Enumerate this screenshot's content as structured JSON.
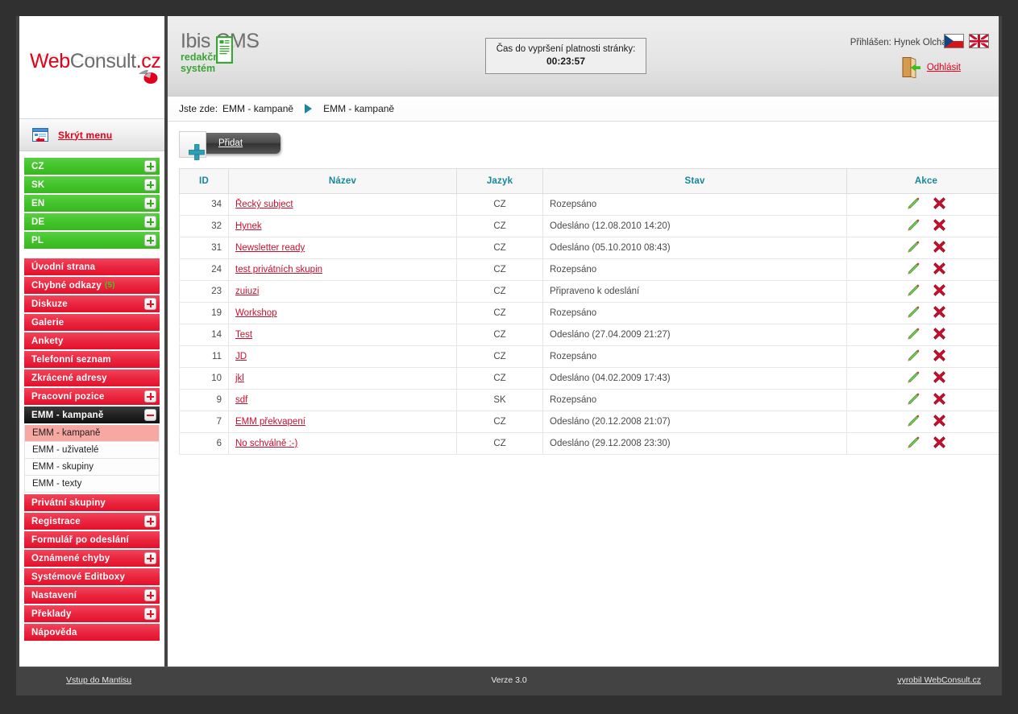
{
  "brand": {
    "logo_web": "Web",
    "logo_consult": "Consult",
    "logo_cz": ".cz",
    "cms_title": "Ibis CMS",
    "cms_sub_line1": "redakční",
    "cms_sub_line2": "systém"
  },
  "sidebar": {
    "hide_menu_label": "Skrýt menu",
    "languages": [
      {
        "label": "CZ",
        "toggle": "plus"
      },
      {
        "label": "SK",
        "toggle": "plus"
      },
      {
        "label": "EN",
        "toggle": "plus"
      },
      {
        "label": "DE",
        "toggle": "plus"
      },
      {
        "label": "PL",
        "toggle": "plus"
      }
    ],
    "menu": [
      {
        "label": "Úvodní strana",
        "toggle": null,
        "badge": null
      },
      {
        "label": "Chybné odkazy",
        "toggle": null,
        "badge": "(5)"
      },
      {
        "label": "Diskuze",
        "toggle": "plus",
        "badge": null
      },
      {
        "label": "Galerie",
        "toggle": null,
        "badge": null
      },
      {
        "label": "Ankety",
        "toggle": null,
        "badge": null
      },
      {
        "label": "Telefonní seznam",
        "toggle": null,
        "badge": null
      },
      {
        "label": "Zkrácené adresy",
        "toggle": null,
        "badge": null
      },
      {
        "label": "Pracovní pozice",
        "toggle": "plus",
        "badge": null
      }
    ],
    "expanded": {
      "label": "EMM - kampaně",
      "toggle": "minus"
    },
    "submenu": [
      {
        "label": "EMM - kampaně",
        "active": true
      },
      {
        "label": "EMM - uživatelé",
        "active": false
      },
      {
        "label": "EMM - skupiny",
        "active": false
      },
      {
        "label": "EMM - texty",
        "active": false
      }
    ],
    "menu_after": [
      {
        "label": "Privátní skupiny",
        "toggle": null,
        "badge": null
      },
      {
        "label": "Registrace",
        "toggle": "plus",
        "badge": null
      },
      {
        "label": "Formulář po odeslání",
        "toggle": null,
        "badge": null
      },
      {
        "label": "Oznámené chyby",
        "toggle": "plus",
        "badge": null
      },
      {
        "label": "Systémové Editboxy",
        "toggle": null,
        "badge": null
      },
      {
        "label": "Nastavení",
        "toggle": "plus",
        "badge": null
      },
      {
        "label": "Překlady",
        "toggle": "plus",
        "badge": null
      },
      {
        "label": "Nápověda",
        "toggle": null,
        "badge": null
      }
    ]
  },
  "topbar": {
    "timer_label": "Čas do vypršení platnosti stránky:",
    "timer_value": "00:23:57",
    "user_label": "Přihlášen: Hynek Olchava",
    "logout_label": "Odhlásit",
    "flag_cz": "flag-cz",
    "flag_en": "flag-en"
  },
  "breadcrumb": {
    "prefix": "Jste zde:",
    "first": "EMM - kampaně",
    "second": "EMM - kampaně"
  },
  "toolbar": {
    "add_label": "Přidat"
  },
  "table": {
    "headers": {
      "id": "ID",
      "name": "Název",
      "lang": "Jazyk",
      "state": "Stav",
      "actions": "Akce"
    },
    "rows": [
      {
        "id": "34",
        "name": "Řecký subject",
        "lang": "CZ",
        "state": "Rozepsáno"
      },
      {
        "id": "32",
        "name": "Hynek",
        "lang": "CZ",
        "state": "Odesláno (12.08.2010 14:20)"
      },
      {
        "id": "31",
        "name": "Newsletter ready",
        "lang": "CZ",
        "state": "Odesláno (05.10.2010 08:43)"
      },
      {
        "id": "24",
        "name": "test privátních skupin",
        "lang": "CZ",
        "state": "Rozepsáno"
      },
      {
        "id": "23",
        "name": "zuiuzi",
        "lang": "CZ",
        "state": "Připraveno k odeslání"
      },
      {
        "id": "19",
        "name": "Workshop",
        "lang": "CZ",
        "state": "Rozepsáno"
      },
      {
        "id": "14",
        "name": "Test",
        "lang": "CZ",
        "state": "Odesláno (27.04.2009 21:27)"
      },
      {
        "id": "11",
        "name": "JD",
        "lang": "CZ",
        "state": "Rozepsáno"
      },
      {
        "id": "10",
        "name": "jkl",
        "lang": "CZ",
        "state": "Odesláno (04.02.2009 17:43)"
      },
      {
        "id": "9",
        "name": "sdf",
        "lang": "SK",
        "state": "Rozepsáno"
      },
      {
        "id": "7",
        "name": "EMM překvapení",
        "lang": "CZ",
        "state": "Odesláno (20.12.2008 21:07)"
      },
      {
        "id": "6",
        "name": "No schválně :-)",
        "lang": "CZ",
        "state": "Odesláno (29.12.2008 23:30)"
      }
    ]
  },
  "footer": {
    "left": "Vstup do Mantisu",
    "center": "Verze 3.0",
    "right": "vyrobil WebConsult.cz"
  },
  "colors": {
    "accent_red": "#e2001a",
    "link_red": "#c8102e",
    "header_teal": "#17879b",
    "green": "#37b81d",
    "frame_dark": "#303030"
  }
}
